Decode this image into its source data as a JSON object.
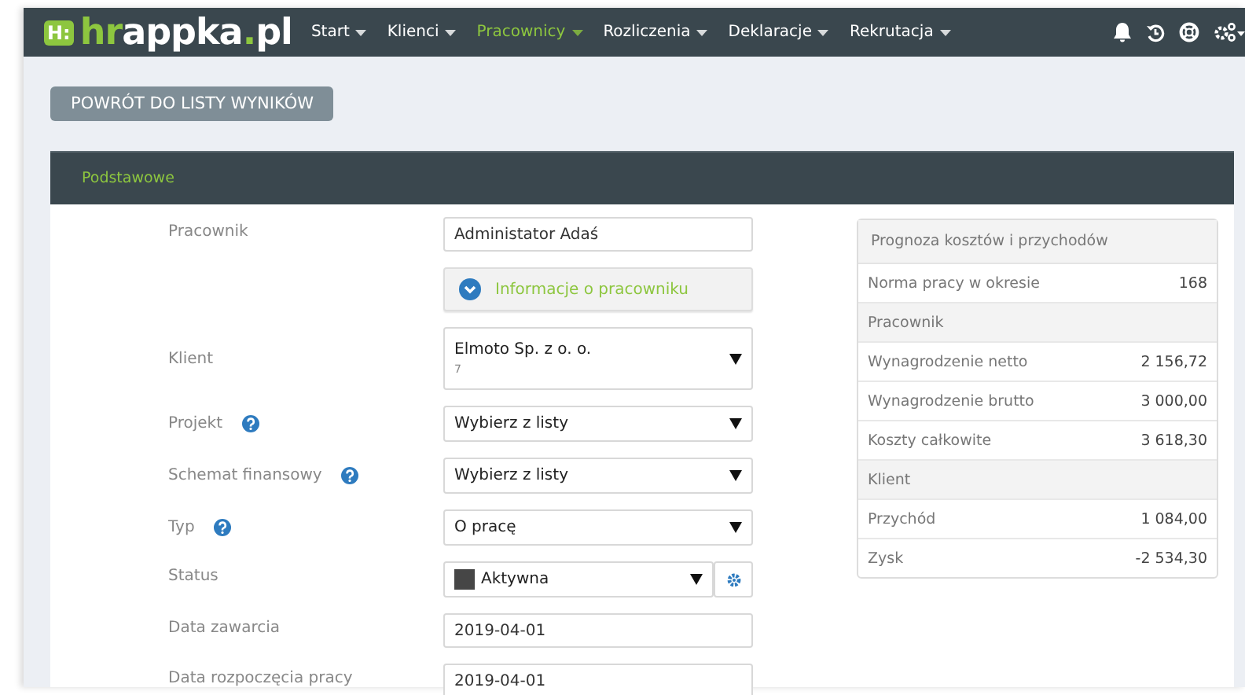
{
  "navbar": {
    "logo": {
      "badge": "H:",
      "parts": [
        {
          "text": "hr",
          "accent": true
        },
        {
          "text": "appka",
          "accent": false
        },
        {
          "text": ".",
          "accent": true
        },
        {
          "text": "pl",
          "accent": false
        }
      ]
    },
    "menu": [
      {
        "label": "Start",
        "selected": false
      },
      {
        "label": "Klienci",
        "selected": false
      },
      {
        "label": "Pracownicy",
        "selected": true
      },
      {
        "label": "Rozliczenia",
        "selected": false
      },
      {
        "label": "Deklaracje",
        "selected": false
      },
      {
        "label": "Rekrutacja",
        "selected": false
      }
    ]
  },
  "back_button": "POWRÓT DO LISTY WYNIKÓW",
  "tabs": [
    {
      "label": "Podstawowe",
      "selected": true
    }
  ],
  "form": [
    {
      "kind": "text",
      "label": "Pracownik",
      "value": "Administator Adaś",
      "help": false
    },
    {
      "kind": "expander",
      "value": "Informacje o pracowniku"
    },
    {
      "kind": "select",
      "label": "Klient",
      "value": "Elmoto Sp. z o. o.",
      "subvalue": "7",
      "help": false
    },
    {
      "kind": "select",
      "label": "Projekt",
      "value": "Wybierz z listy",
      "help": true
    },
    {
      "kind": "select",
      "label": "Schemat finansowy",
      "value": "Wybierz z listy",
      "help": true
    },
    {
      "kind": "select",
      "label": "Typ",
      "value": "O pracę",
      "help": true
    },
    {
      "kind": "status",
      "label": "Status",
      "value": "Aktywna",
      "color": "#464646",
      "help": false
    },
    {
      "kind": "text",
      "label": "Data zawarcia",
      "value": "2019-04-01",
      "help": false
    },
    {
      "kind": "text",
      "label": "Data rozpoczęcia pracy",
      "value": "2019-04-01",
      "help": false
    }
  ],
  "forecast": {
    "title": "Prognoza kosztów i przychodów",
    "rows": [
      {
        "kind": "row",
        "label": "Norma pracy w okresie",
        "value": "168"
      },
      {
        "kind": "section",
        "label": "Pracownik"
      },
      {
        "kind": "row",
        "label": "Wynagrodzenie netto",
        "value": "2 156,72"
      },
      {
        "kind": "row",
        "label": "Wynagrodzenie brutto",
        "value": "3 000,00"
      },
      {
        "kind": "row",
        "label": "Koszty całkowite",
        "value": "3 618,30"
      },
      {
        "kind": "section",
        "label": "Klient"
      },
      {
        "kind": "row",
        "label": "Przychód",
        "value": "1 084,00"
      },
      {
        "kind": "row",
        "label": "Zysk",
        "value": "-2 534,30"
      }
    ]
  }
}
